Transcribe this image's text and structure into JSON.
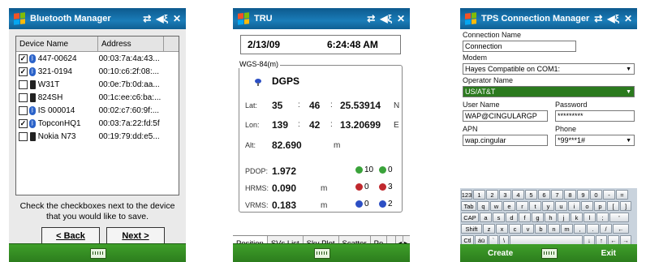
{
  "screen1": {
    "title": "Bluetooth Manager",
    "columns": [
      "Device Name",
      "Address"
    ],
    "devices": [
      {
        "checked": true,
        "icon": "bluetooth-icon",
        "name": "447-00624",
        "address": "00:03:7a:4a:43..."
      },
      {
        "checked": true,
        "icon": "bluetooth-icon",
        "name": "321-0194",
        "address": "00:10:c6:2f:08:..."
      },
      {
        "checked": false,
        "icon": "phone-icon",
        "name": "W31T",
        "address": "00:0e:7b:0d:aa..."
      },
      {
        "checked": false,
        "icon": "phone-icon",
        "name": "824SH",
        "address": "00:1c:ee:c6:ba:..."
      },
      {
        "checked": false,
        "icon": "bluetooth-icon",
        "name": "IS 000014",
        "address": "00:02:c7:60:9f:..."
      },
      {
        "checked": true,
        "icon": "bluetooth-icon",
        "name": "TopconHQ1",
        "address": "00:03:7a:22:fd:5f"
      },
      {
        "checked": false,
        "icon": "phone-icon",
        "name": "Nokia N73",
        "address": "00:19:79:dd:e5..."
      }
    ],
    "instruction": "Check the checkboxes next to the device that you would like to save.",
    "back_label": "< Back",
    "next_label": "Next >"
  },
  "screen2": {
    "title": "TRU",
    "date": "2/13/09",
    "time": "6:24:48 AM",
    "frame_label": "WGS-84(m)",
    "fix_type": "DGPS",
    "lat": {
      "label": "Lat:",
      "deg": "35",
      "min": "46",
      "sec": "25.53914",
      "hem": "N"
    },
    "lon": {
      "label": "Lon:",
      "deg": "139",
      "min": "42",
      "sec": "13.20699",
      "hem": "E"
    },
    "alt": {
      "label": "Alt:",
      "value": "82.690",
      "unit": "m"
    },
    "pdop": {
      "label": "PDOP:",
      "value": "1.972"
    },
    "hrms": {
      "label": "HRMS:",
      "value": "0.090",
      "unit": "m"
    },
    "vrms": {
      "label": "VRMS:",
      "value": "0.183",
      "unit": "m"
    },
    "sats": [
      {
        "count": "10",
        "color": "#3aa33a"
      },
      {
        "count": "0",
        "color": "#3aa33a"
      },
      {
        "count": "0",
        "color": "#c0282d"
      },
      {
        "count": "3",
        "color": "#c0282d"
      },
      {
        "count": "0",
        "color": "#2c4fc4"
      },
      {
        "count": "2",
        "color": "#2c4fc4"
      }
    ],
    "tabs": [
      "Position",
      "SVs List",
      "Sky Plot",
      "Scatter",
      "Po"
    ]
  },
  "screen3": {
    "title": "TPS Connection Manager",
    "conn_name_label": "Connection Name",
    "conn_name_value": "Connection",
    "modem_label": "Modem",
    "modem_value": "Hayes Compatible on COM1:",
    "operator_label": "Operator Name",
    "operator_value": "US/AT&T",
    "user_label": "User Name",
    "user_value": "WAP@CINGULARGP",
    "password_label": "Password",
    "password_value": "*********",
    "apn_label": "APN",
    "apn_value": "wap.cingular",
    "phone_label": "Phone",
    "phone_value": "*99***1#",
    "keyboard_rows": [
      [
        "123",
        "1",
        "2",
        "3",
        "4",
        "5",
        "6",
        "7",
        "8",
        "9",
        "0",
        "-",
        "="
      ],
      [
        "Tab",
        "q",
        "w",
        "e",
        "r",
        "t",
        "y",
        "u",
        "i",
        "o",
        "p",
        "[",
        "]"
      ],
      [
        "CAP",
        "a",
        "s",
        "d",
        "f",
        "g",
        "h",
        "j",
        "k",
        "l",
        ";",
        "'"
      ],
      [
        "Shift",
        "z",
        "x",
        "c",
        "v",
        "b",
        "n",
        "m",
        ",",
        ".",
        "/",
        "←"
      ],
      [
        "Ctl",
        "áü",
        "`",
        "\\",
        "",
        "",
        "",
        "↓",
        "↑",
        "←",
        "→"
      ]
    ],
    "create_label": "Create",
    "exit_label": "Exit"
  }
}
